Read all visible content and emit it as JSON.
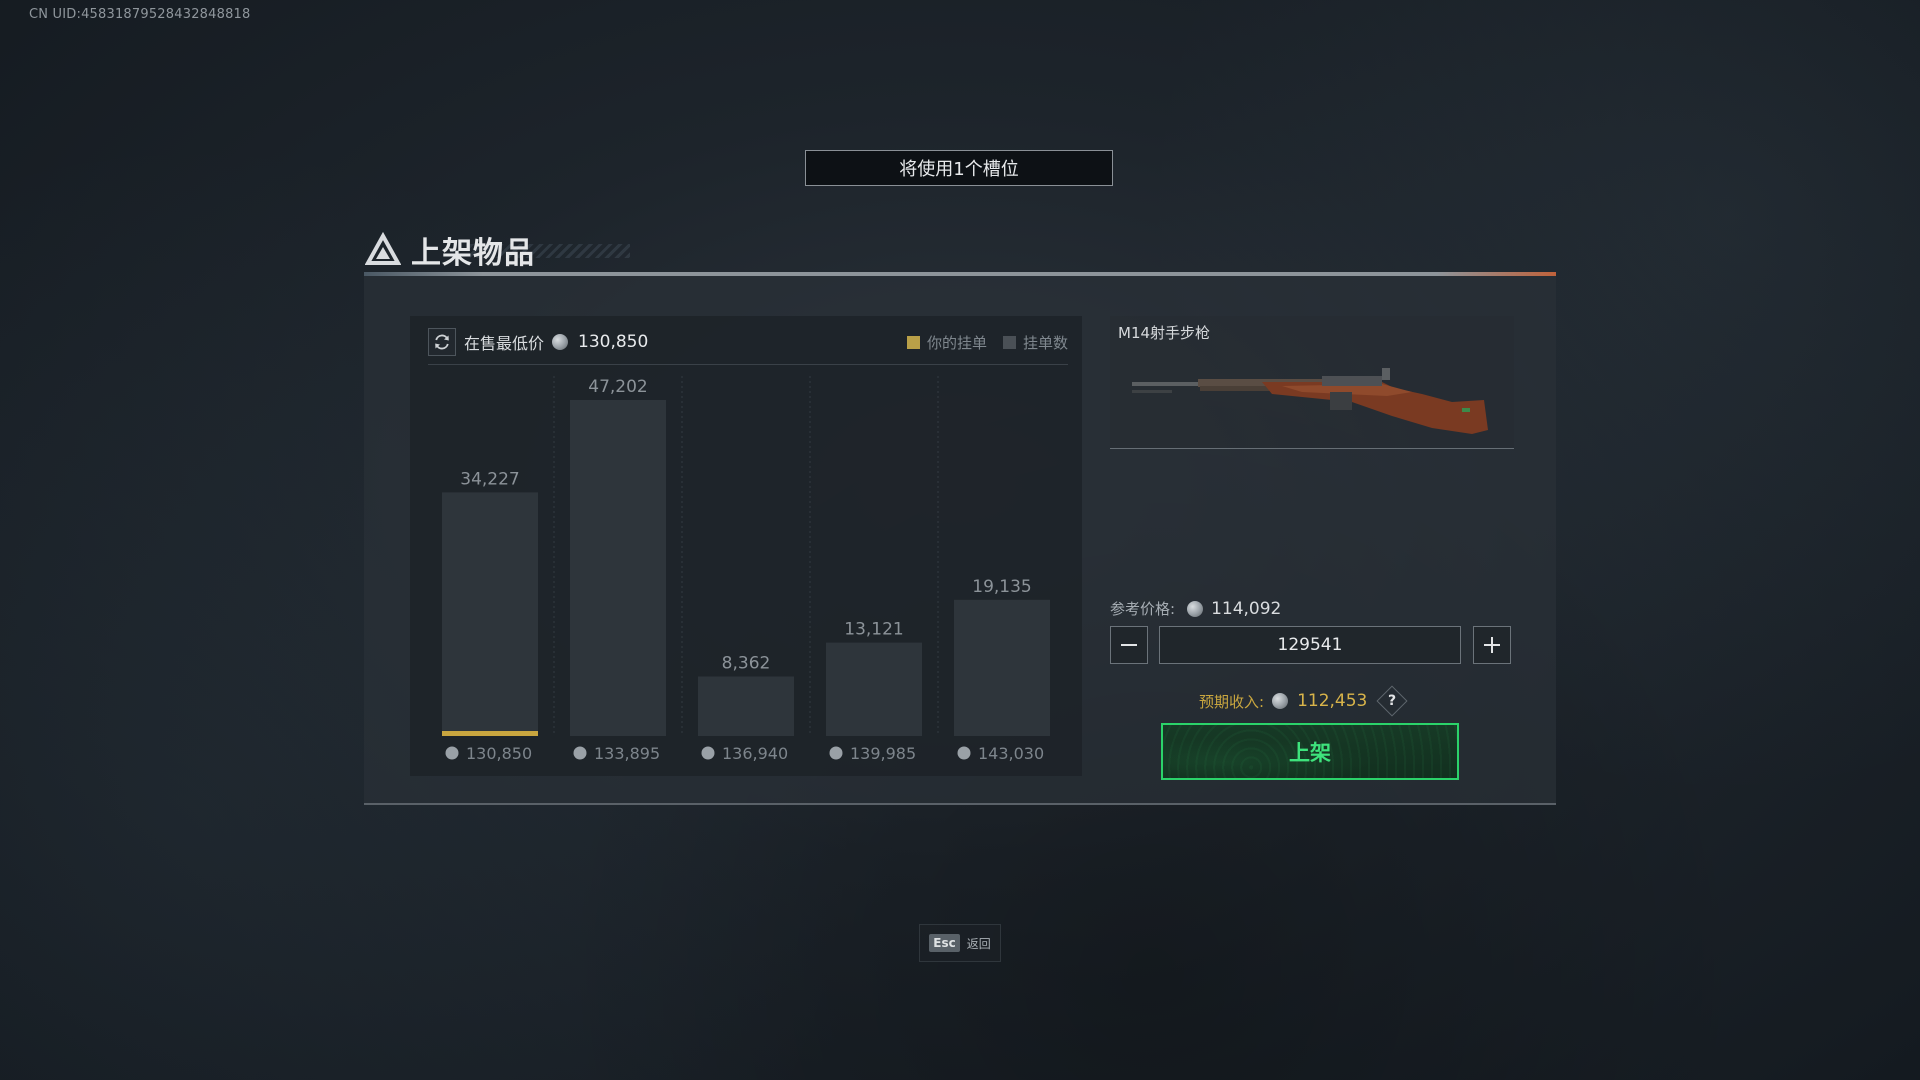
{
  "uid": "CN UID:45831879528432848818",
  "slot_banner": "将使用1个槽位",
  "title": "上架物品",
  "chart_header": {
    "label": "在售最低价",
    "value": "130,850",
    "legend": [
      "你的挂单",
      "挂单数"
    ]
  },
  "chart_data": {
    "type": "bar",
    "categories": [
      "130,850",
      "133,895",
      "136,940",
      "139,985",
      "143,030"
    ],
    "values": [
      34227,
      47202,
      8362,
      13121,
      19135
    ],
    "value_labels": [
      "34,227",
      "47,202",
      "8,362",
      "13,121",
      "19,135"
    ],
    "highlight_category": "130,850",
    "series": [
      {
        "name": "挂单数",
        "values": [
          34227,
          47202,
          8362,
          13121,
          19135
        ]
      }
    ],
    "ylim": [
      0,
      47202
    ],
    "colors": {
      "bar": "#2e353b",
      "highlight": "#c9a63f",
      "legend_yours": "#b9a048",
      "legend_count": "#4a5056"
    }
  },
  "item": {
    "name": "M14射手步枪"
  },
  "reference_price": {
    "label": "参考价格:",
    "value": "114,092"
  },
  "price_input": {
    "value": "129541"
  },
  "expected_income": {
    "label": "预期收入:",
    "value": "112,453",
    "help": "?"
  },
  "list_button": "上架",
  "esc": {
    "key": "Esc",
    "label": "返回"
  },
  "colors": {
    "accent_green": "#2bd36a",
    "gold": "#c9a63f"
  }
}
